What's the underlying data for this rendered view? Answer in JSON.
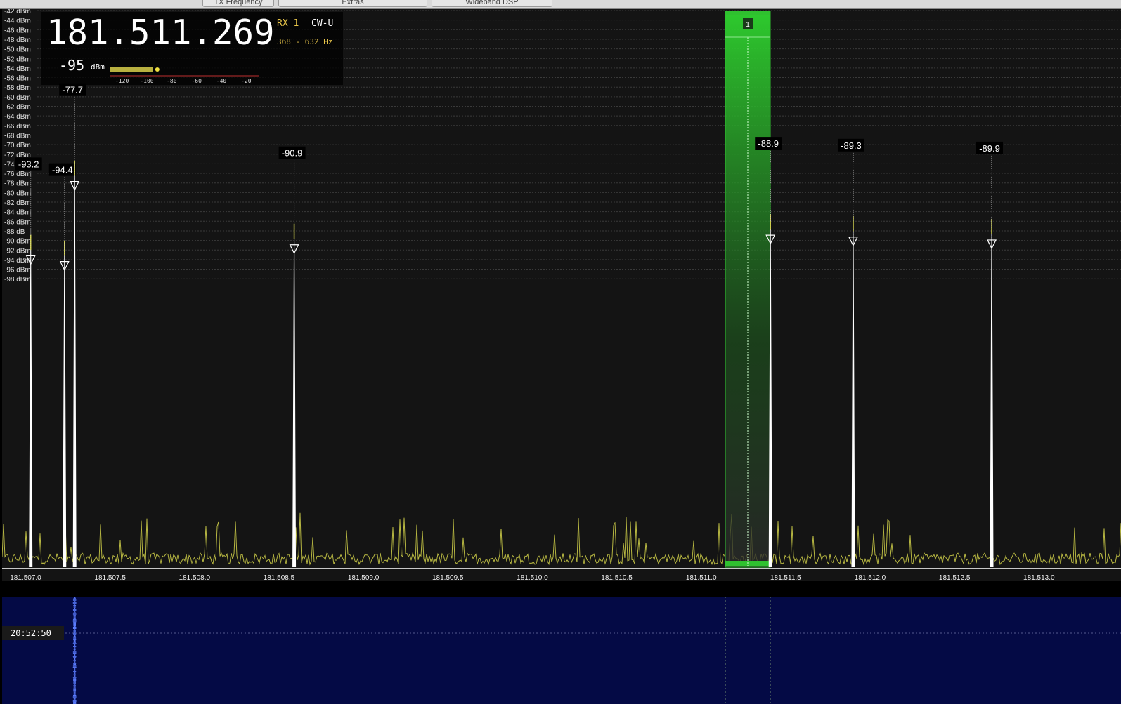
{
  "tabs": [
    {
      "label": "TX Frequency"
    },
    {
      "label": "Extras"
    },
    {
      "label": "Wideband DSP"
    }
  ],
  "vfo": {
    "frequency": "181.511.269",
    "receiver": "RX 1",
    "mode": "CW-U",
    "bandwidth": "368 - 632 Hz",
    "signal_value": "-95",
    "signal_unit": "dBm",
    "smeter_ticks": [
      "-120",
      "-100",
      "-80",
      "-60",
      "-40",
      "-20"
    ],
    "smeter_level_dbm": -95
  },
  "spectrum": {
    "dbm_labels": [
      "-42 dBm",
      "-44 dBm",
      "-46 dBm",
      "-48 dBm",
      "-50 dBm",
      "-52 dBm",
      "-54 dBm",
      "-56 dBm",
      "-58 dBm",
      "-60 dBm",
      "-62 dBm",
      "-64 dBm",
      "-66 dBm",
      "-68 dBm",
      "-70 dBm",
      "-72 dBm",
      "-74 dBm",
      "-76 dBm",
      "-78 dBm",
      "-80 dBm",
      "-82 dBm",
      "-84 dBm",
      "-86 dBm",
      "-88 dB",
      "-90 dBm",
      "-92 dBm",
      "-94 dBm",
      "-96 dBm",
      "-98 dBm"
    ],
    "freq_labels": [
      "181.507.0",
      "181.507.5",
      "181.508.0",
      "181.508.5",
      "181.509.0",
      "181.509.5",
      "181.510.0",
      "181.510.5",
      "181.511.0",
      "181.511.5",
      "181.512.0",
      "181.512.5",
      "181.513.0"
    ],
    "passband_marker": "1",
    "peaks": [
      {
        "label": "-93.2",
        "freq_khz": 181507.03,
        "dbm": -93.2
      },
      {
        "label": "-94.4",
        "freq_khz": 181507.23,
        "dbm": -94.4
      },
      {
        "label": "-77.7",
        "freq_khz": 181507.29,
        "dbm": -77.7
      },
      {
        "label": "-90.9",
        "freq_khz": 181508.59,
        "dbm": -90.9
      },
      {
        "label": "-88.9",
        "freq_khz": 181511.41,
        "dbm": -88.9
      },
      {
        "label": "-89.3",
        "freq_khz": 181511.9,
        "dbm": -89.3
      },
      {
        "label": "-89.9",
        "freq_khz": 181512.72,
        "dbm": -89.9
      }
    ],
    "noise_color": "#d4d44a",
    "passband_color": "#2fc12f",
    "trace_color": "#ffffff"
  },
  "waterfall": {
    "timestamp": "20:52:50",
    "background": "#040a45",
    "signal_color": "#5a7cff"
  }
}
